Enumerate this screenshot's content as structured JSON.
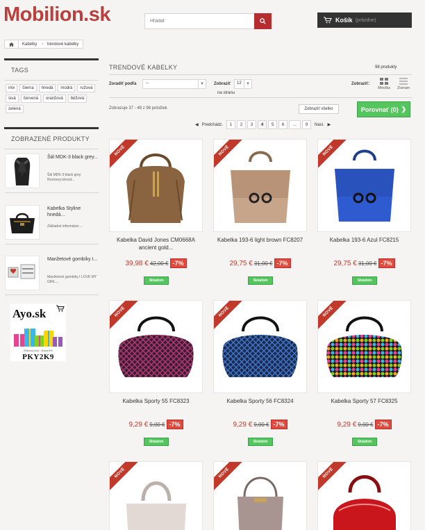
{
  "header": {
    "logo": "Mobilion.sk",
    "search_placeholder": "Hľadať",
    "cart_label": "Košík",
    "cart_status": "(prázdne)"
  },
  "breadcrumb": [
    "Kabelky",
    "trendové kabelky"
  ],
  "sidebar": {
    "tags_title": "TAGS",
    "tags": [
      "mix",
      "čierna",
      "hnedá",
      "modrá",
      "ružová",
      "sivá",
      "červená",
      "oranžová",
      "béžová",
      "zelená"
    ],
    "viewed_title": "ZOBRAZENÉ PRODUKTY",
    "viewed": [
      {
        "title": "Šál MDK-3 black grey...",
        "desc": "Šál MDK-3 black grey Rozmery:obvod..."
      },
      {
        "title": "Kabelka Styline hnedá...",
        "desc": "Základné informácie:..."
      },
      {
        "title": "Manžetové gombíky I...",
        "desc": "Manžetové gombíky I LOVE MY GIRL..."
      }
    ],
    "banner": {
      "brand": "Ayo.sk",
      "promo": "Zľavový kód - zľava 5%",
      "code": "PKY2K9"
    }
  },
  "category": {
    "title": "TRENDOVÉ KABELKY",
    "count": "98 produkty",
    "sort_label": "Zoradiť podľa",
    "sort_value": "--",
    "show_label": "Zobraziť",
    "show_value": "12",
    "per_page": "na stranu",
    "view_label": "Zobraziť:",
    "view_grid": "Mriežka",
    "view_list": "Zoznam",
    "showing": "Zobrazuje 37 - 48 z 98 položiek",
    "show_all": "Zobraziť všetko",
    "compare": "Porovnať (0)"
  },
  "pagination": {
    "prev": "Predchádz.",
    "pages": [
      "1",
      "2",
      "3",
      "4",
      "5",
      "6",
      "...",
      "9"
    ],
    "next": "Nasl."
  },
  "products": [
    {
      "name": "Kabelka David Jones CM0668A ancient gold...",
      "price": "39,98 €",
      "old": "42,00 €",
      "disc": "-7%",
      "badge": "NOVÉ",
      "stock": "Skladom"
    },
    {
      "name": "Kabelka 193-6 light brown FC8207",
      "price": "29,75 €",
      "old": "31,00 €",
      "disc": "-7%",
      "badge": "NOVÉ",
      "stock": "Skladom"
    },
    {
      "name": "Kabelka 193-6 Azul FC8215",
      "price": "29,75 €",
      "old": "31,00 €",
      "disc": "-7%",
      "badge": "NOVÉ",
      "stock": "Skladom"
    },
    {
      "name": "Kabelka Sporty 55 FC8323",
      "price": "9,29 €",
      "old": "9,00 €",
      "disc": "-7%",
      "badge": "NOVÉ",
      "stock": "Skladom"
    },
    {
      "name": "Kabelka Sporty 56 FC8324",
      "price": "9,29 €",
      "old": "9,00 €",
      "disc": "-7%",
      "badge": "NOVÉ",
      "stock": "Skladom"
    },
    {
      "name": "Kabelka Sporty 57 FC8325",
      "price": "9,29 €",
      "old": "9,00 €",
      "disc": "-7%",
      "badge": "NOVÉ",
      "stock": "Skladom"
    },
    {
      "badge": "NOVÉ"
    },
    {
      "badge": "NOVÉ"
    },
    {
      "badge": "NOVÉ"
    }
  ]
}
